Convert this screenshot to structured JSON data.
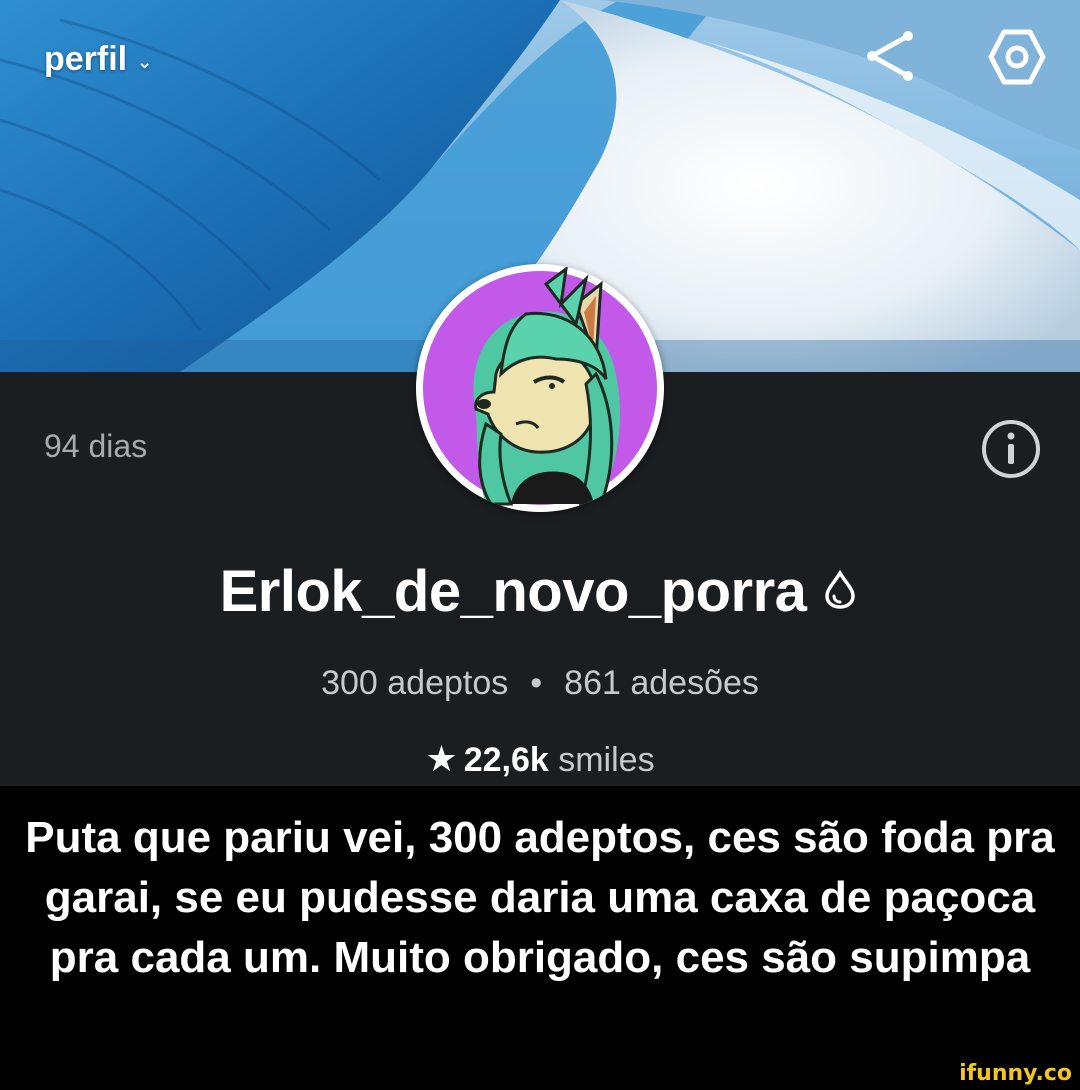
{
  "header": {
    "title": "perfil",
    "dropdown_icon": "chevron-down-icon",
    "share_icon": "share-icon",
    "settings_icon": "settings-icon"
  },
  "profile": {
    "days": "94 dias",
    "username": "Erlok_de_novo_porra",
    "badge_icon": "drop-icon",
    "followers": "300 adeptos",
    "separator": "•",
    "subscriptions": "861 adesões",
    "star_icon": "star-icon",
    "smiles_count": "22,6k",
    "smiles_label": "smiles",
    "info_icon": "info-icon"
  },
  "caption": "Puta que pariu vei, 300 adeptos, ces são foda pra garai, se eu pudesse daria uma caxa de paçoca pra cada um. Muito obrigado, ces são supimpa",
  "watermark": "ifunny.co",
  "colors": {
    "panel_background": "#1b1e21",
    "avatar_background": "#c259e8",
    "watermark": "#f6c51b"
  }
}
